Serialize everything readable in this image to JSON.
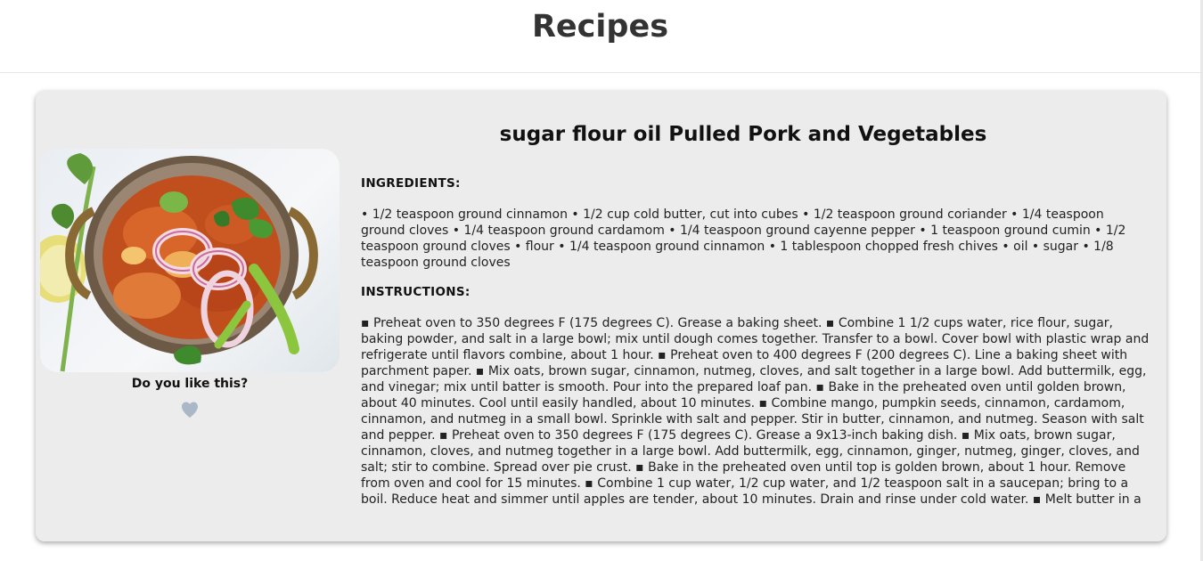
{
  "page": {
    "title": "Recipes"
  },
  "recipe": {
    "title": "sugar flour oil Pulled Pork and Vegetables",
    "image_alt": "dish-photo",
    "like_prompt": "Do you like this?",
    "liked": false,
    "ingredients_heading": "INGREDIENTS:",
    "ingredients_text": "• 1/2 teaspoon ground cinnamon • 1/2 cup cold butter, cut into cubes • 1/2 teaspoon ground coriander • 1/4 teaspoon ground cloves • 1/4 teaspoon ground cardamom • 1/4 teaspoon ground cayenne pepper • 1 teaspoon ground cumin • 1/2 teaspoon ground cloves • flour • 1/4 teaspoon ground cinnamon • 1 tablespoon chopped fresh chives • oil • sugar • 1/8 teaspoon ground cloves",
    "instructions_heading": "INSTRUCTIONS:",
    "instructions_text": "▪ Preheat oven to 350 degrees F (175 degrees C). Grease a baking sheet. ▪ Combine 1 1/2 cups water, rice flour, sugar, baking powder, and salt in a large bowl; mix until dough comes together. Transfer to a bowl. Cover bowl with plastic wrap and refrigerate until flavors combine, about 1 hour. ▪ Preheat oven to 400 degrees F (200 degrees C). Line a baking sheet with parchment paper. ▪ Mix oats, brown sugar, cinnamon, nutmeg, cloves, and salt together in a large bowl. Add buttermilk, egg, and vinegar; mix until batter is smooth. Pour into the prepared loaf pan. ▪ Bake in the preheated oven until golden brown, about 40 minutes. Cool until easily handled, about 10 minutes. ▪ Combine mango, pumpkin seeds, cinnamon, cardamom, cinnamon, and nutmeg in a small bowl. Sprinkle with salt and pepper. Stir in butter, cinnamon, and nutmeg. Season with salt and pepper. ▪ Preheat oven to 350 degrees F (175 degrees C). Grease a 9x13-inch baking dish. ▪ Mix oats, brown sugar, cinnamon, cloves, and nutmeg together in a large bowl. Add buttermilk, egg, cinnamon, ginger, nutmeg, ginger, cloves, and salt; stir to combine. Spread over pie crust. ▪ Bake in the preheated oven until top is golden brown, about 1 hour. Remove from oven and cool for 15 minutes. ▪ Combine 1 cup water, 1/2 cup water, and 1/2 teaspoon salt in a saucepan; bring to a boil. Reduce heat and simmer until apples are tender, about 10 minutes. Drain and rinse under cold water. ▪ Melt butter in a"
  },
  "icons": {
    "like": "heart-icon"
  },
  "colors": {
    "heart": "#a9b7c6",
    "card_background": "#ececec"
  }
}
